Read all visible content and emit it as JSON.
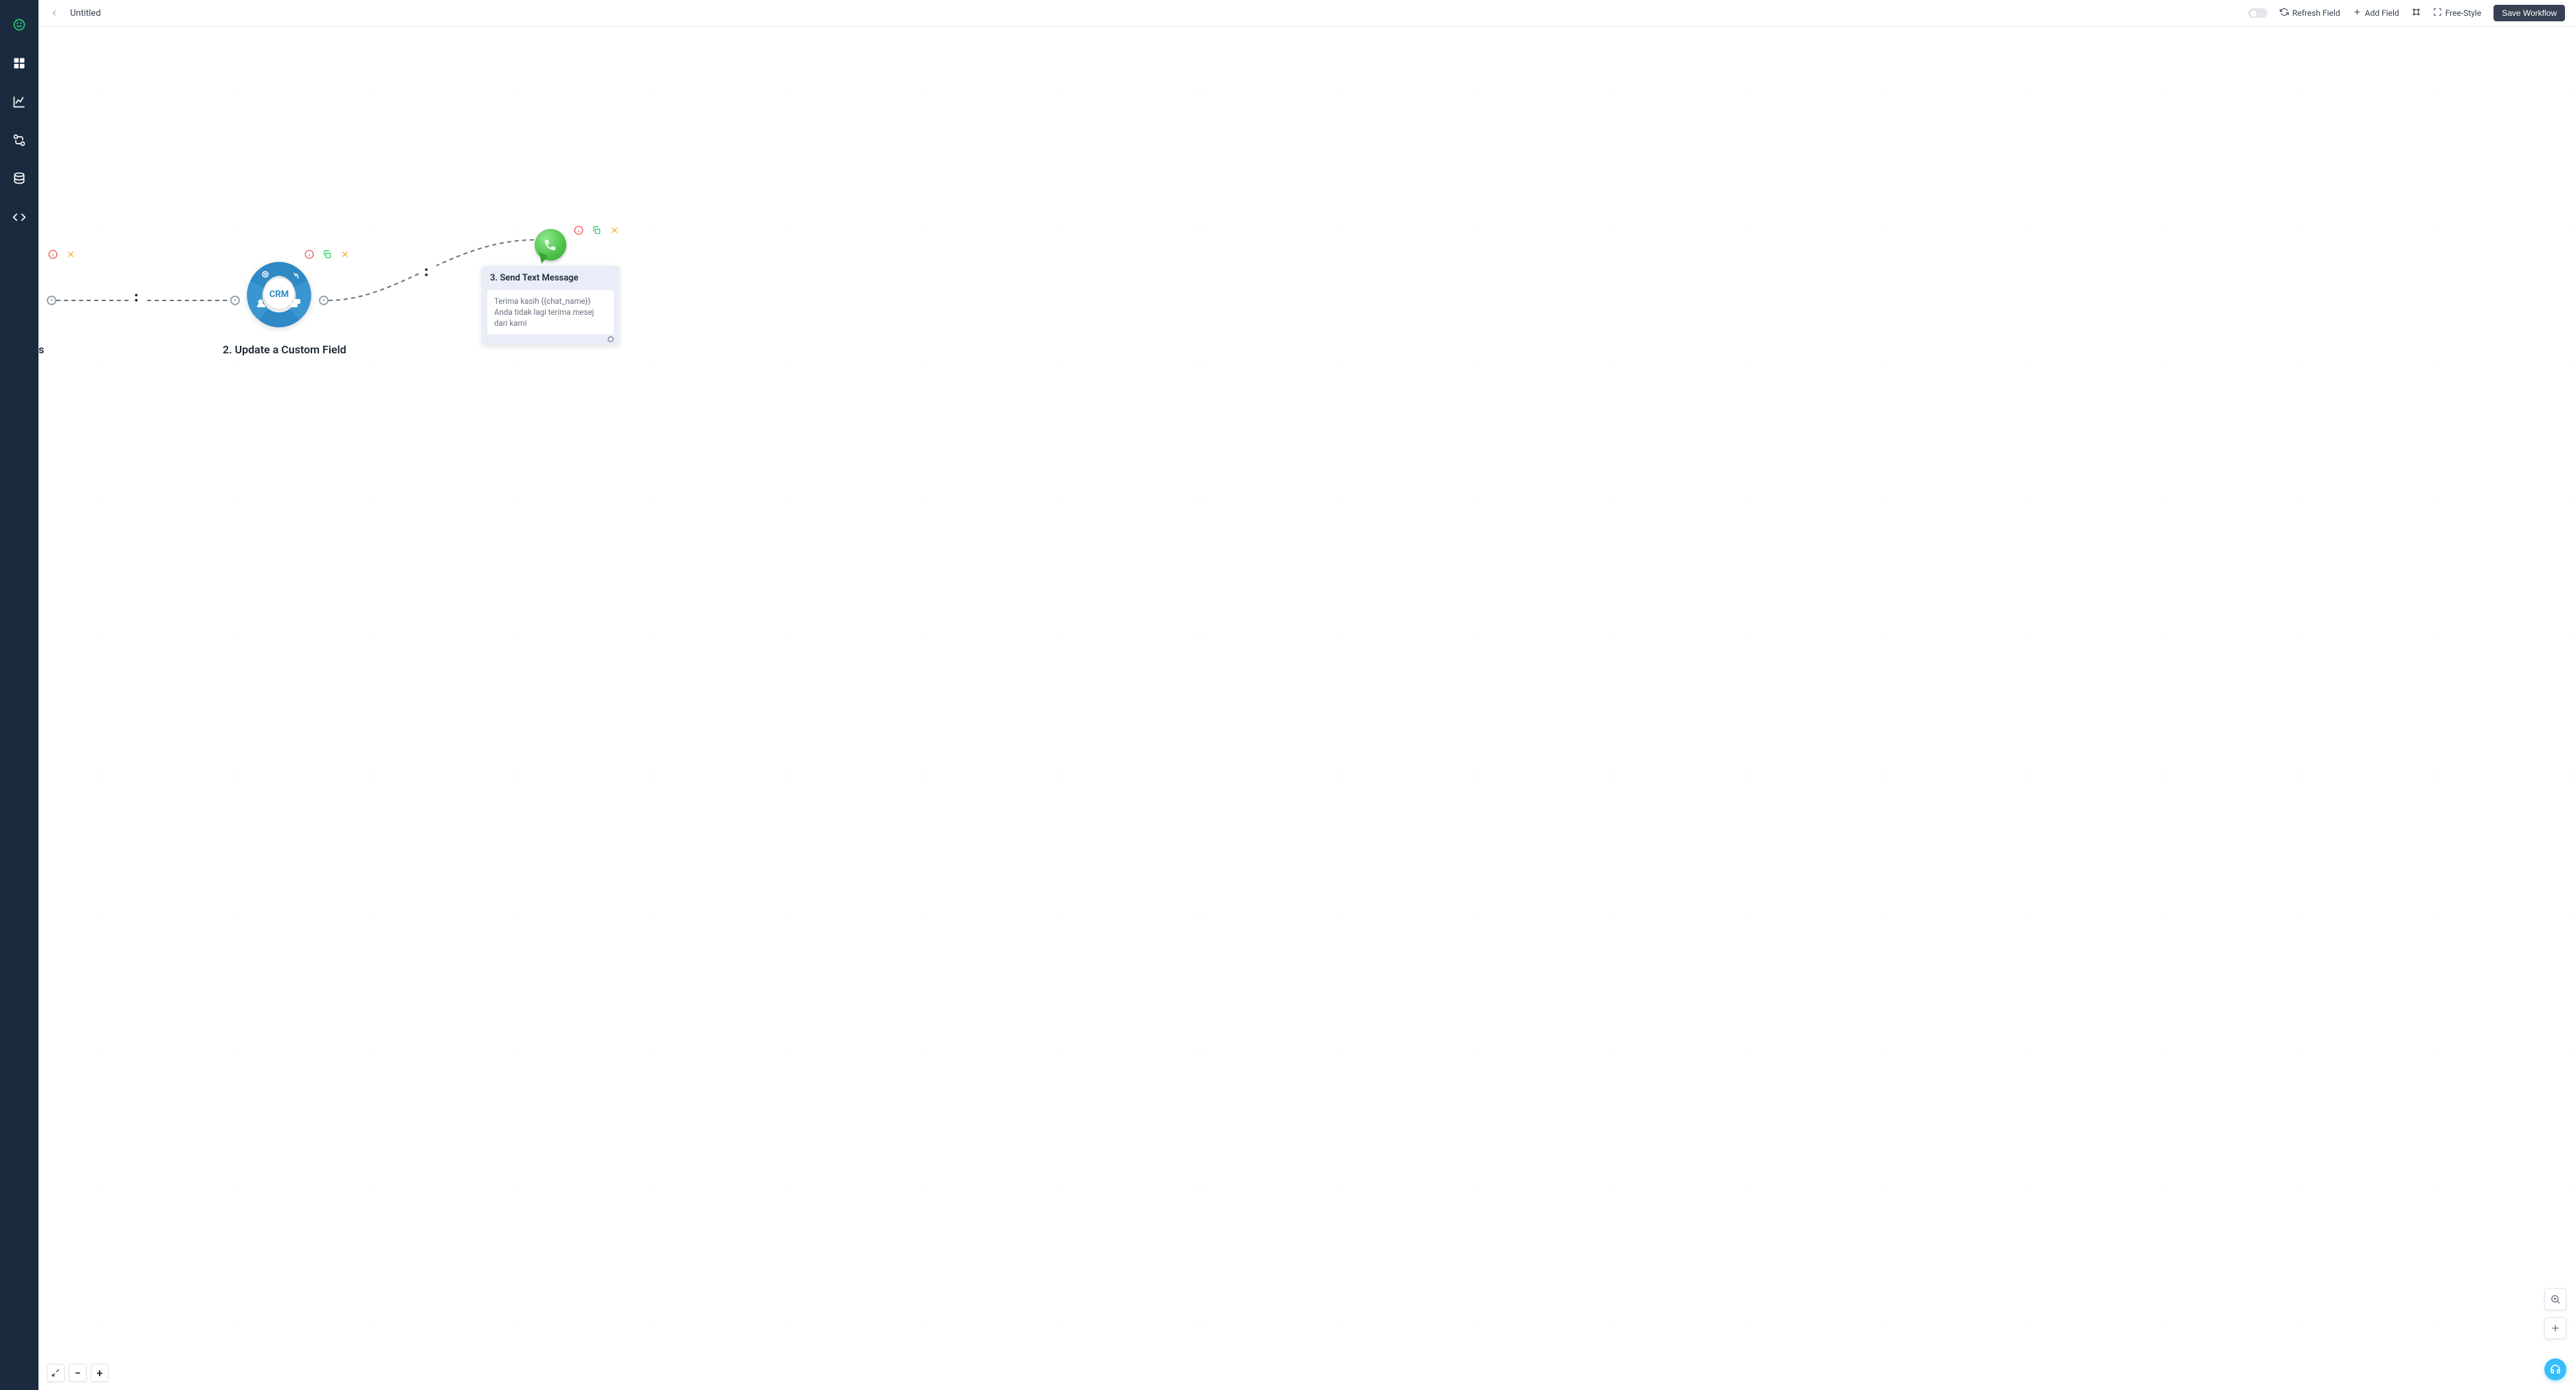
{
  "header": {
    "title": "Untitled",
    "refresh_label": "Refresh Field",
    "add_field_label": "Add Field",
    "freestyle_label": "Free-Style",
    "save_label": "Save Workflow"
  },
  "canvas": {
    "partial_node_label_suffix": "s",
    "node2": {
      "label": "2. Update a Custom Field",
      "icon_text": "CRM"
    },
    "node3": {
      "title": "3. Send Text Message",
      "message_line1": "Terima kasih {{chat_name}}",
      "message_line2": "Anda tidak lagi terima mesej dari kami"
    }
  },
  "sidebar": {
    "items": [
      "logo",
      "dashboard",
      "analytics",
      "flows",
      "database",
      "code"
    ]
  }
}
